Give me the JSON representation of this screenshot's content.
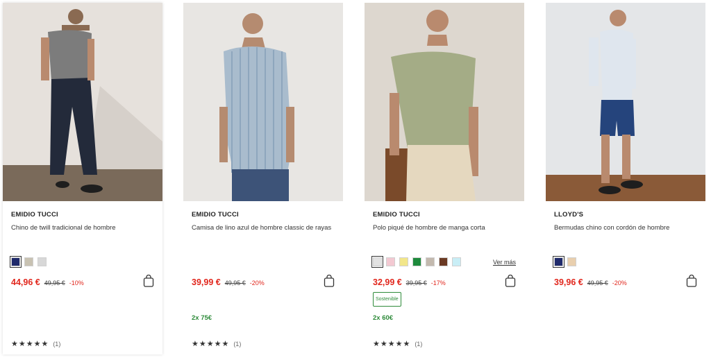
{
  "products": [
    {
      "brand": "EMIDIO TUCCI",
      "name": "Chino de twill tradicional de hombre",
      "price": "44,96 €",
      "old_price": "49,95 €",
      "discount": "-10%",
      "swatches": [
        "#1f2a6b",
        "#c8c2b2",
        "#d8d8d8"
      ],
      "promo": "",
      "badge": "",
      "rating_stars": "★★★★★",
      "rating_count": "(1)"
    },
    {
      "brand": "EMIDIO TUCCI",
      "name": "Camisa de lino azul de hombre classic de rayas",
      "price": "39,99 €",
      "old_price": "49,95 €",
      "discount": "-20%",
      "swatches": [],
      "promo": "2x 75€",
      "badge": "",
      "rating_stars": "★★★★★",
      "rating_count": "(1)"
    },
    {
      "brand": "EMIDIO TUCCI",
      "name": "Polo piqué de hombre de manga corta",
      "price": "32,99 €",
      "old_price": "39,95 €",
      "discount": "-17%",
      "swatches": [
        "#e2e2e2",
        "#f3c9d2",
        "#f2e68a",
        "#1e8a3c",
        "#c3b9ae",
        "#6b3a24",
        "#c9eef6"
      ],
      "more_colors": "Ver más",
      "promo": "2x 60€",
      "badge": "Sostenible",
      "rating_stars": "★★★★★",
      "rating_count": "(1)"
    },
    {
      "brand": "LLOYD'S",
      "name": "Bermudas chino con cordón de hombre",
      "price": "39,96 €",
      "old_price": "49,95 €",
      "discount": "-20%",
      "swatches": [
        "#1f2a6b",
        "#e9cfae"
      ],
      "promo": "",
      "badge": "",
      "rating_stars": "",
      "rating_count": ""
    }
  ],
  "icons": {
    "bag": "shopping-bag-icon"
  }
}
